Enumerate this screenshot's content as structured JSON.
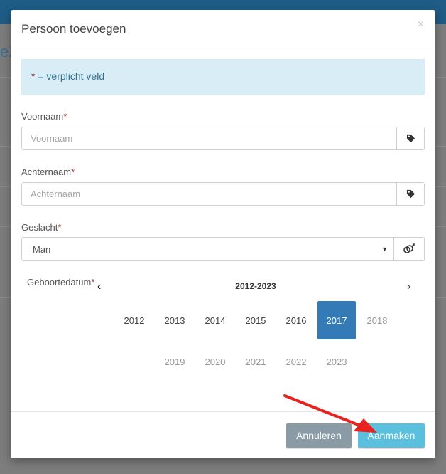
{
  "background": {
    "title_fragment": "eZ"
  },
  "modal": {
    "title": "Persoon toevoegen",
    "close_glyph": "×",
    "notice": {
      "star": "*",
      "text": " = verplicht veld"
    }
  },
  "form": {
    "first_name": {
      "label": "Voornaam",
      "star": "*",
      "placeholder": "Voornaam",
      "value": "",
      "icon": "tag-icon"
    },
    "last_name": {
      "label": "Achternaam",
      "star": "*",
      "placeholder": "Achternaam",
      "value": "",
      "icon": "tag-icon"
    },
    "gender": {
      "label": "Geslacht",
      "star": "*",
      "selected": "Man",
      "icon": "gender-icon"
    },
    "birthdate": {
      "label": "Geboortedatum",
      "star": "*",
      "range": "2012-2023",
      "prev_glyph": "‹",
      "next_glyph": "›",
      "years_row1": [
        "2012",
        "2013",
        "2014",
        "2015",
        "2016",
        "2017",
        "2018"
      ],
      "years_row2": [
        "2019",
        "2020",
        "2021",
        "2022",
        "2023"
      ],
      "selected_year": "2017"
    }
  },
  "footer": {
    "cancel_label": "Annuleren",
    "create_label": "Aanmaken"
  },
  "colors": {
    "primary": "#337ab7",
    "info_button": "#5bc0de",
    "cancel_button": "#8a9ba6",
    "annotation_arrow": "#e8231f"
  }
}
